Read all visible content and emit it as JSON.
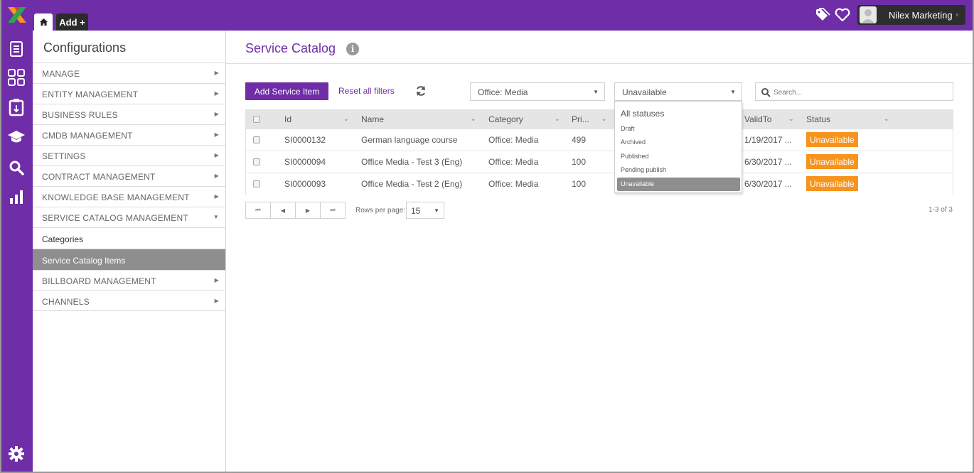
{
  "topbar": {
    "home_tab": "home",
    "add_tab": "Add +",
    "user_name": "Nilex Marketing",
    "user_caret": "▾"
  },
  "rail": {
    "icons": [
      "document-icon",
      "dashboard-grid-icon",
      "clipboard-icon",
      "graduation-cap-icon",
      "search-icon",
      "bar-chart-icon",
      "settings-gear-icon"
    ]
  },
  "sidebar": {
    "title": "Configurations",
    "items": [
      {
        "label": "MANAGE",
        "arrow": "▶"
      },
      {
        "label": "ENTITY MANAGEMENT",
        "arrow": "▶"
      },
      {
        "label": "BUSINESS RULES",
        "arrow": "▶"
      },
      {
        "label": "CMDB MANAGEMENT",
        "arrow": "▶"
      },
      {
        "label": "SETTINGS",
        "arrow": "▶"
      },
      {
        "label": "CONTRACT MANAGEMENT",
        "arrow": "▶"
      },
      {
        "label": "KNOWLEDGE BASE MANAGEMENT",
        "arrow": "▶"
      },
      {
        "label": "SERVICE CATALOG MANAGEMENT",
        "arrow": "▼"
      }
    ],
    "sub_items": [
      {
        "label": "Categories"
      },
      {
        "label": "Service Catalog Items"
      }
    ],
    "after_items": [
      {
        "label": "BILLBOARD MANAGEMENT",
        "arrow": "▶"
      },
      {
        "label": "CHANNELS",
        "arrow": "▶"
      }
    ]
  },
  "main": {
    "title": "Service Catalog",
    "info_glyph": "i",
    "add_button": "Add Service Item",
    "reset_link": "Reset all filters",
    "category_filter": "Office: Media",
    "status_filter": "Unavailable",
    "select_caret": "▼",
    "search_placeholder": "Search..."
  },
  "table": {
    "columns": [
      "Id",
      "Name",
      "Category",
      "Pri...",
      "ValidTo",
      "Status"
    ],
    "header_caret": "⌄",
    "rows": [
      {
        "id": "SI0000132",
        "name": "German language course",
        "category": "Office: Media",
        "price": "499",
        "valid_to": "1/19/2017 ...",
        "status": "Unavailable"
      },
      {
        "id": "SI0000094",
        "name": "Office Media - Test 3 (Eng)",
        "category": "Office: Media",
        "price": "100",
        "valid_to": "6/30/2017 ...",
        "status": "Unavailable"
      },
      {
        "id": "SI0000093",
        "name": "Office Media - Test 2 (Eng)",
        "category": "Office: Media",
        "price": "100",
        "valid_to": "6/30/2017 ...",
        "status": "Unavailable"
      }
    ]
  },
  "pager": {
    "first": "⏮",
    "prev": "◀",
    "next": "▶",
    "last": "⏭",
    "rows_per_page_label": "Rows per page:",
    "rows_per_page": "15",
    "count": "1-3 of 3"
  },
  "status_dropdown": {
    "options": [
      "All statuses",
      "Draft",
      "Archived",
      "Published",
      "Pending publish",
      "Unavailable"
    ],
    "selected": "Unavailable"
  },
  "colors": {
    "brand": "#6f2da8",
    "status_badge": "#f7941d",
    "active_nav": "#8e8e8e"
  }
}
